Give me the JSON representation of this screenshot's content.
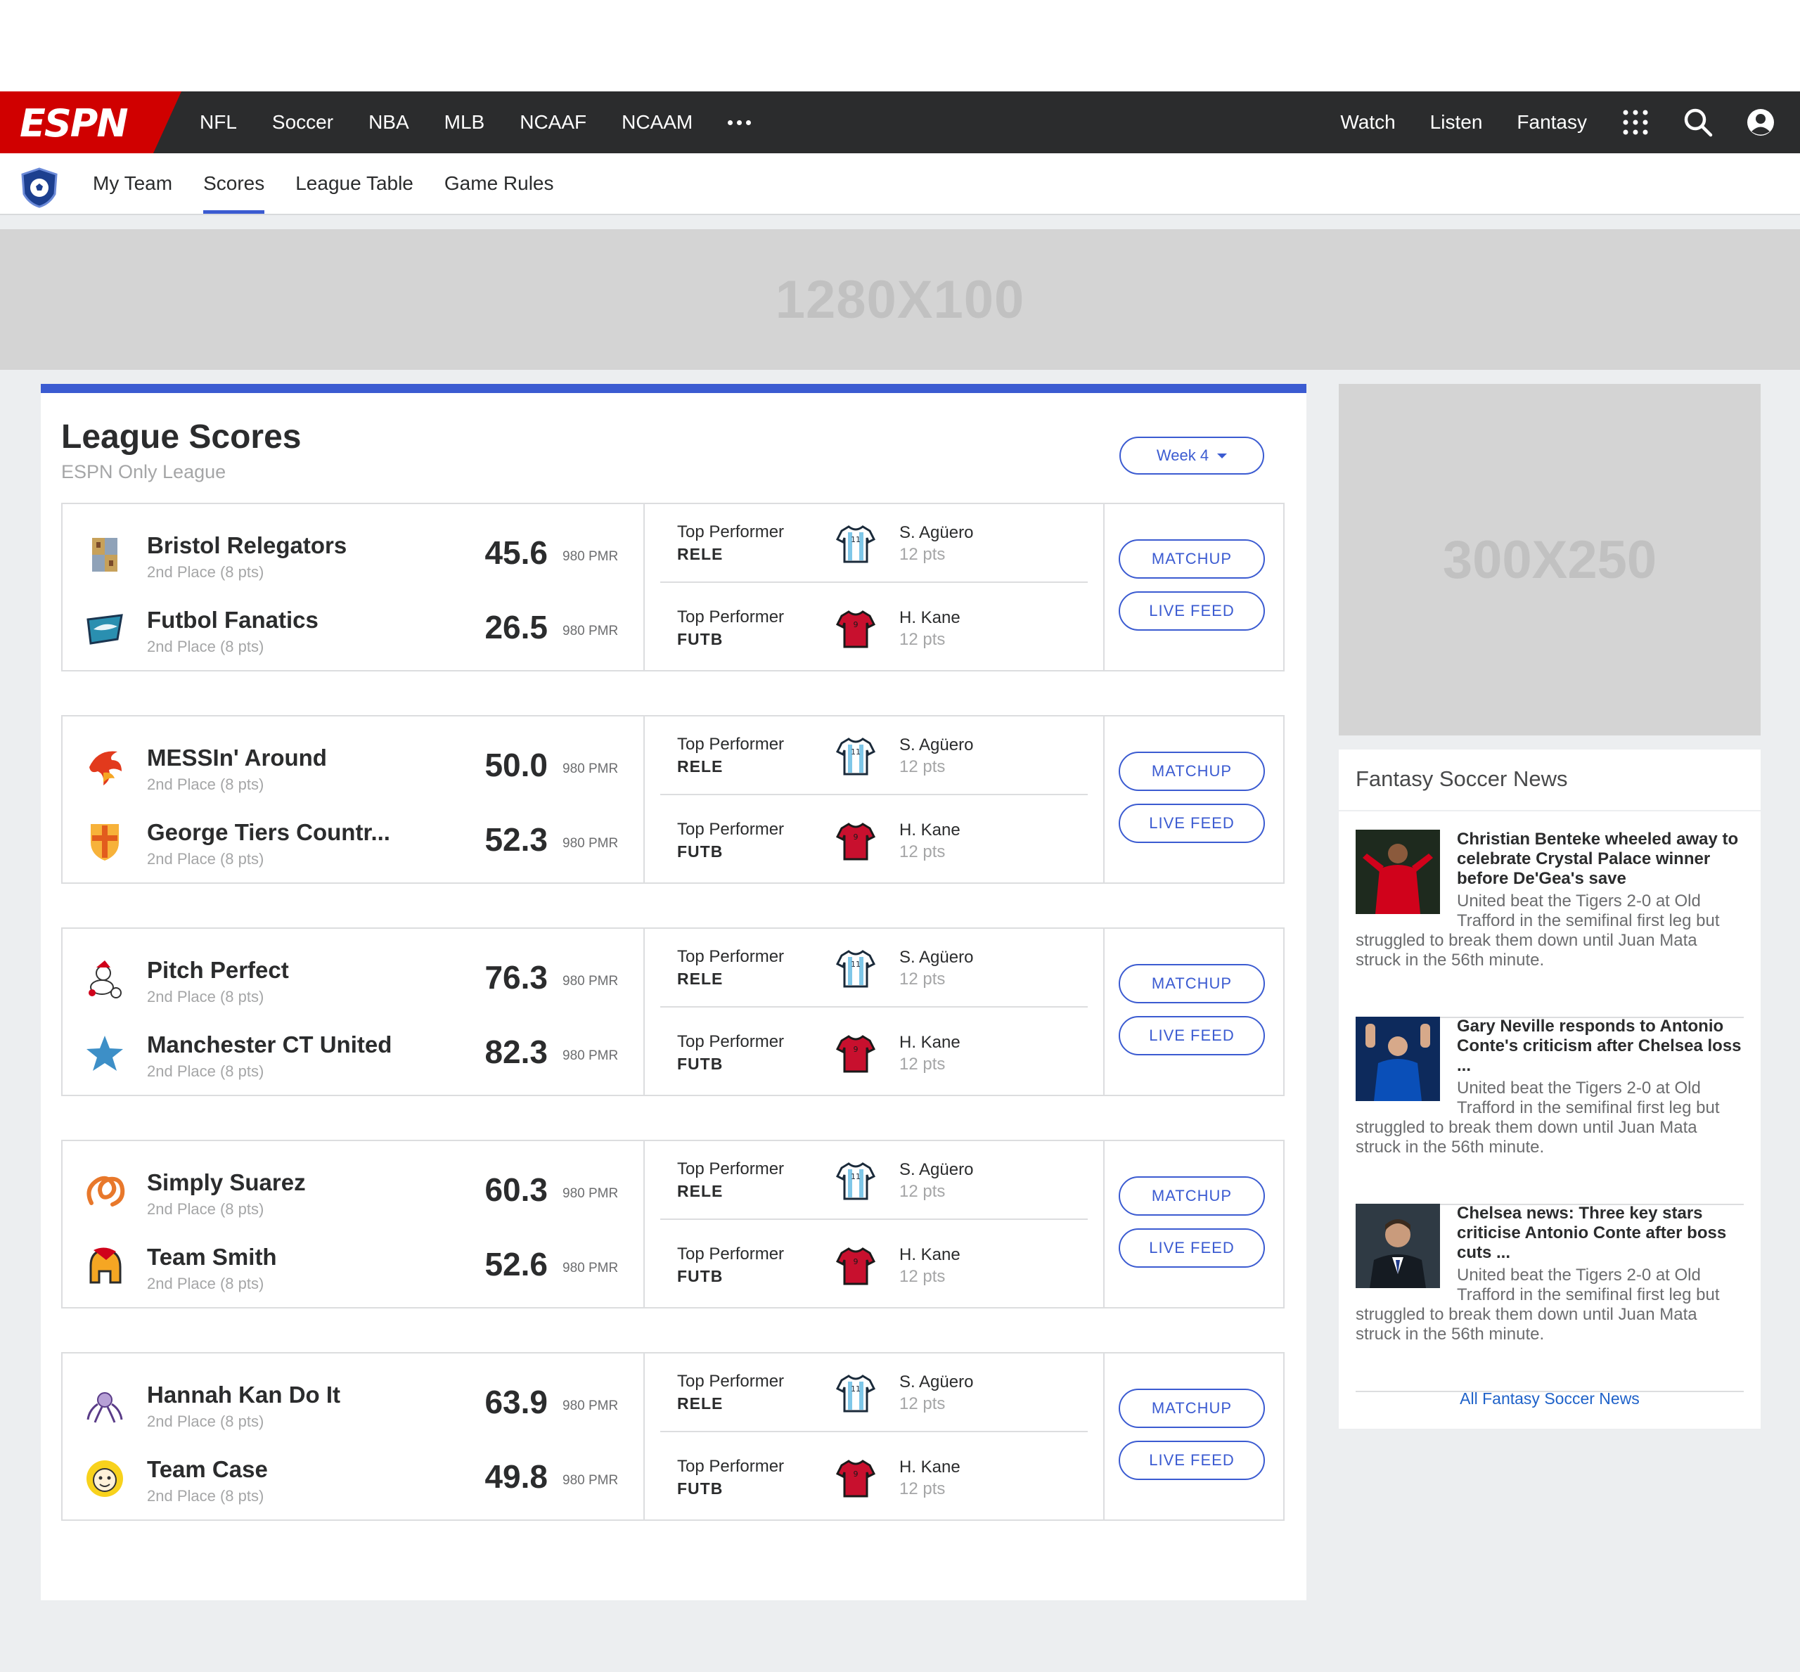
{
  "nav": {
    "logo": "ESPN",
    "links": [
      "NFL",
      "Soccer",
      "NBA",
      "MLB",
      "NCAAF",
      "NCAAM"
    ],
    "more_icon": "ellipsis-icon",
    "right_links": [
      "Watch",
      "Listen",
      "Fantasy"
    ],
    "icons": [
      "apps-grid-icon",
      "search-icon",
      "account-icon"
    ]
  },
  "subnav": {
    "league_icon": "soccer-shield-icon",
    "tabs": [
      "My Team",
      "Scores",
      "League Table",
      "Game Rules"
    ],
    "active_tab": "Scores"
  },
  "ads": {
    "top": "1280X100",
    "side": "300X250"
  },
  "main": {
    "title": "League Scores",
    "subtitle": "ESPN Only League",
    "week_label": "Week 4",
    "perf_label": "Top Performer",
    "matchup_label": "MATCHUP",
    "live_feed_label": "LIVE FEED",
    "matchups": [
      {
        "teams": [
          {
            "name": "Bristol Relegators",
            "rank": "2nd Place (8 pts)",
            "score": "45.6",
            "pmr": "980 PMR",
            "logo": "castle-shield-logo"
          },
          {
            "name": "Futbol Fanatics",
            "rank": "2nd Place (8 pts)",
            "score": "26.5",
            "pmr": "980 PMR",
            "logo": "shark-logo"
          }
        ],
        "performers": [
          {
            "team": "RELE",
            "player": "S. Agüero",
            "pts": "12 pts",
            "shirt": "striped-shirt-icon"
          },
          {
            "team": "FUTB",
            "player": "H. Kane",
            "pts": "12 pts",
            "shirt": "red-shirt-icon"
          }
        ]
      },
      {
        "teams": [
          {
            "name": "MESSIn' Around",
            "rank": "2nd Place (8 pts)",
            "score": "50.0",
            "pmr": "980 PMR",
            "logo": "phoenix-logo"
          },
          {
            "name": "George Tiers Countr...",
            "rank": "2nd Place (8 pts)",
            "score": "52.3",
            "pmr": "980 PMR",
            "logo": "cross-shield-logo"
          }
        ],
        "performers": [
          {
            "team": "RELE",
            "player": "S. Agüero",
            "pts": "12 pts",
            "shirt": "striped-shirt-icon"
          },
          {
            "team": "FUTB",
            "player": "H. Kane",
            "pts": "12 pts",
            "shirt": "red-shirt-icon"
          }
        ]
      },
      {
        "teams": [
          {
            "name": "Pitch Perfect",
            "rank": "2nd Place (8 pts)",
            "score": "76.3",
            "pmr": "980 PMR",
            "logo": "mascot-logo"
          },
          {
            "name": "Manchester CT United",
            "rank": "2nd Place (8 pts)",
            "score": "82.3",
            "pmr": "980 PMR",
            "logo": "star-logo"
          }
        ],
        "performers": [
          {
            "team": "RELE",
            "player": "S. Agüero",
            "pts": "12 pts",
            "shirt": "striped-shirt-icon"
          },
          {
            "team": "FUTB",
            "player": "H. Kane",
            "pts": "12 pts",
            "shirt": "red-shirt-icon"
          }
        ]
      },
      {
        "teams": [
          {
            "name": "Simply Suarez",
            "rank": "2nd Place (8 pts)",
            "score": "60.3",
            "pmr": "980 PMR",
            "logo": "pretzel-logo"
          },
          {
            "name": "Team Smith",
            "rank": "2nd Place (8 pts)",
            "score": "52.6",
            "pmr": "980 PMR",
            "logo": "spartan-helmet-logo"
          }
        ],
        "performers": [
          {
            "team": "RELE",
            "player": "S. Agüero",
            "pts": "12 pts",
            "shirt": "striped-shirt-icon"
          },
          {
            "team": "FUTB",
            "player": "H. Kane",
            "pts": "12 pts",
            "shirt": "red-shirt-icon"
          }
        ]
      },
      {
        "teams": [
          {
            "name": "Hannah Kan Do It",
            "rank": "2nd Place (8 pts)",
            "score": "63.9",
            "pmr": "980 PMR",
            "logo": "octopus-logo"
          },
          {
            "name": "Team Case",
            "rank": "2nd Place (8 pts)",
            "score": "49.8",
            "pmr": "980 PMR",
            "logo": "face-logo"
          }
        ],
        "performers": [
          {
            "team": "RELE",
            "player": "S. Agüero",
            "pts": "12 pts",
            "shirt": "striped-shirt-icon"
          },
          {
            "team": "FUTB",
            "player": "H. Kane",
            "pts": "12 pts",
            "shirt": "red-shirt-icon"
          }
        ]
      }
    ]
  },
  "news": {
    "header": "Fantasy Soccer News",
    "items": [
      {
        "headline": "Christian Benteke wheeled away to celebrate Crystal Palace winner before De'Gea's save",
        "body": "United beat the Tigers 2-0 at Old Trafford in the semifinal first leg but struggled to break them down until Juan Mata struck in the 56th minute.",
        "thumb": "red-kit-player-photo"
      },
      {
        "headline": "Gary Neville responds to Antonio Conte's criticism after Chelsea loss ...",
        "body": "United beat the Tigers 2-0 at Old Trafford in the semifinal first leg but struggled to break them down until Juan Mata struck in the 56th minute.",
        "thumb": "blue-kit-player-photo"
      },
      {
        "headline": "Chelsea news: Three key stars criticise Antonio Conte after boss cuts ...",
        "body": "United beat the Tigers 2-0 at Old Trafford in the semifinal first leg but struggled to break them down until Juan Mata struck in the 56th minute.",
        "thumb": "manager-photo"
      }
    ],
    "all_link": "All Fantasy Soccer News"
  },
  "colors": {
    "accent": "#3b5bd1",
    "espn_red": "#d00000",
    "nav_bg": "#2b2c2d"
  }
}
